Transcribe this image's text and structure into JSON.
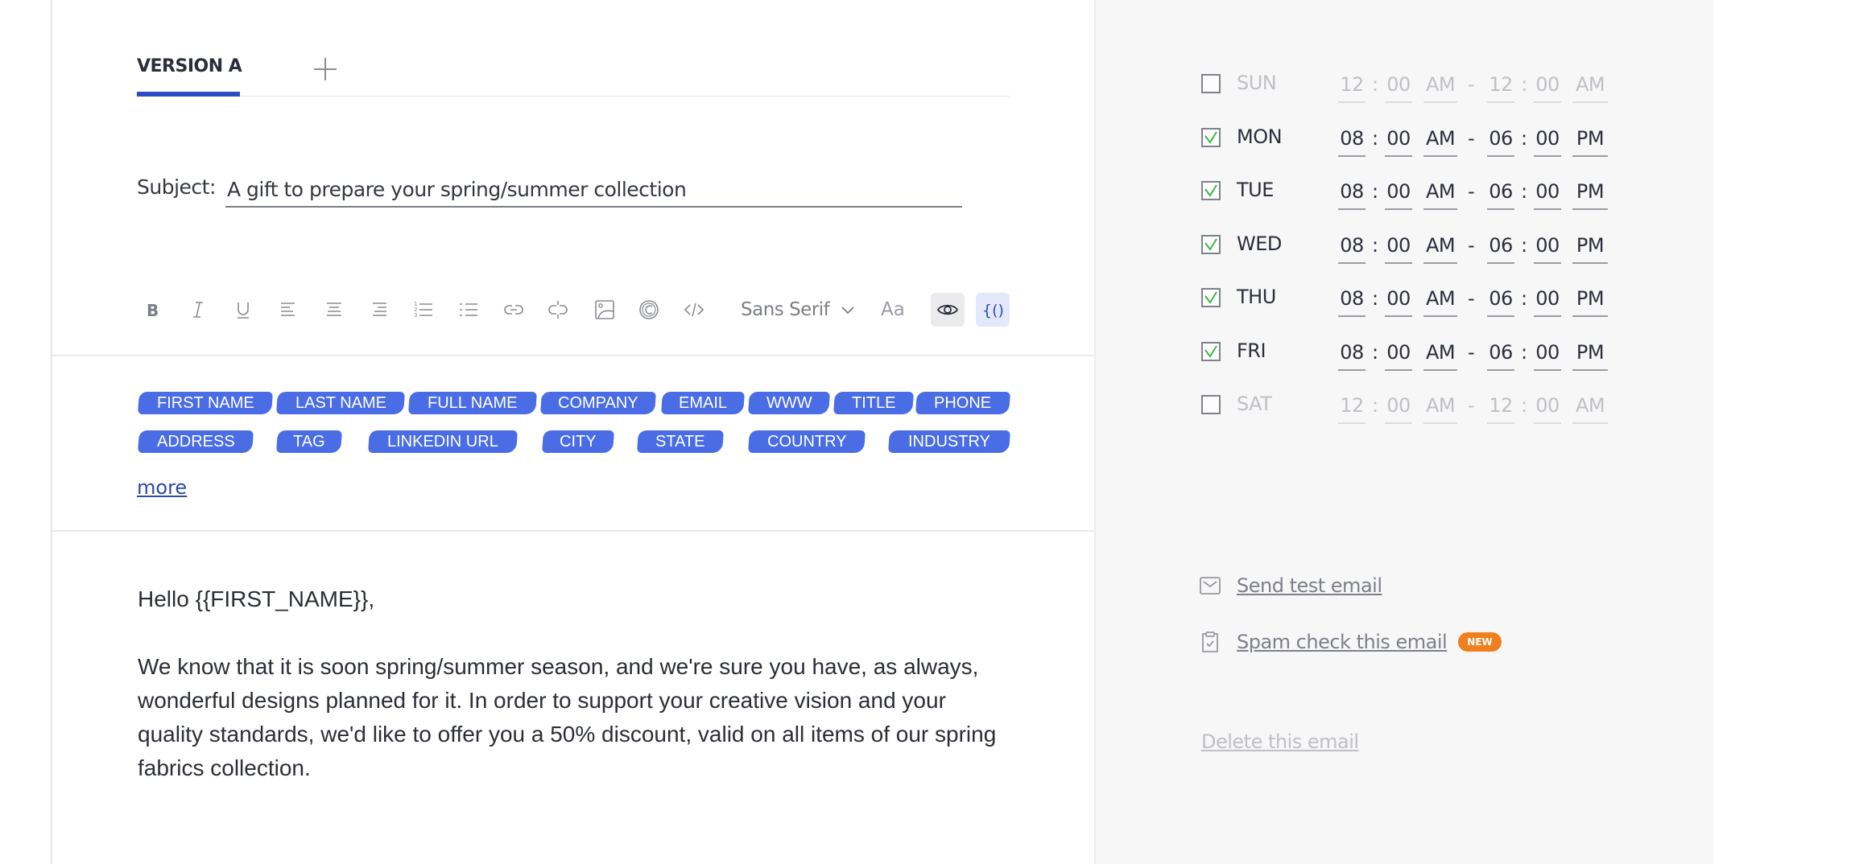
{
  "editor": {
    "tabs": [
      {
        "label": "VERSION A",
        "active": true
      }
    ],
    "add_tab_icon": "plus-icon",
    "subject": {
      "label": "Subject:",
      "value": "A gift to prepare your spring/summer collection"
    },
    "toolbar": {
      "buttons": [
        "bold",
        "italic",
        "underline",
        "align-left",
        "align-center",
        "align-right",
        "ordered-list",
        "bullet-list",
        "link",
        "unlink",
        "image",
        "copyright-symbol",
        "code"
      ],
      "font_family": "Sans Serif",
      "font_size_label": "Aa",
      "preview_toggle": "eye-icon",
      "variables_toggle": "braces-icon"
    },
    "variable_tags": [
      "FIRST NAME",
      "LAST NAME",
      "FULL NAME",
      "COMPANY",
      "EMAIL",
      "WWW",
      "TITLE",
      "PHONE",
      "ADDRESS",
      "TAG",
      "LINKEDIN URL",
      "CITY",
      "STATE",
      "COUNTRY",
      "INDUSTRY"
    ],
    "more_label": "more",
    "body": {
      "greeting": "Hello {{FIRST_NAME}},",
      "paragraph": "We know that it is soon spring/summer season, and we're sure you have, as always, wonderful designs planned for it. In order to support your creative vision and your quality standards, we'd like to offer you a 50% discount, valid on all items of our spring fabrics collection."
    }
  },
  "schedule": {
    "days": [
      {
        "day": "SUN",
        "enabled": false,
        "start_h": "12",
        "start_m": "00",
        "start_ampm": "AM",
        "end_h": "12",
        "end_m": "00",
        "end_ampm": "AM"
      },
      {
        "day": "MON",
        "enabled": true,
        "start_h": "08",
        "start_m": "00",
        "start_ampm": "AM",
        "end_h": "06",
        "end_m": "00",
        "end_ampm": "PM"
      },
      {
        "day": "TUE",
        "enabled": true,
        "start_h": "08",
        "start_m": "00",
        "start_ampm": "AM",
        "end_h": "06",
        "end_m": "00",
        "end_ampm": "PM"
      },
      {
        "day": "WED",
        "enabled": true,
        "start_h": "08",
        "start_m": "00",
        "start_ampm": "AM",
        "end_h": "06",
        "end_m": "00",
        "end_ampm": "PM"
      },
      {
        "day": "THU",
        "enabled": true,
        "start_h": "08",
        "start_m": "00",
        "start_ampm": "AM",
        "end_h": "06",
        "end_m": "00",
        "end_ampm": "PM"
      },
      {
        "day": "FRI",
        "enabled": true,
        "start_h": "08",
        "start_m": "00",
        "start_ampm": "AM",
        "end_h": "06",
        "end_m": "00",
        "end_ampm": "PM"
      },
      {
        "day": "SAT",
        "enabled": false,
        "start_h": "12",
        "start_m": "00",
        "start_ampm": "AM",
        "end_h": "12",
        "end_m": "00",
        "end_ampm": "AM"
      }
    ],
    "time_separator": ":",
    "range_separator": "-"
  },
  "actions": {
    "send_test": "Send test email",
    "spam_check": "Spam check this email",
    "spam_badge": "NEW",
    "delete": "Delete this email"
  },
  "colors": {
    "accent": "#2b4cc4",
    "tag_bg": "#4a6de5",
    "check": "#3fb74a",
    "badge": "#f07f1e"
  }
}
